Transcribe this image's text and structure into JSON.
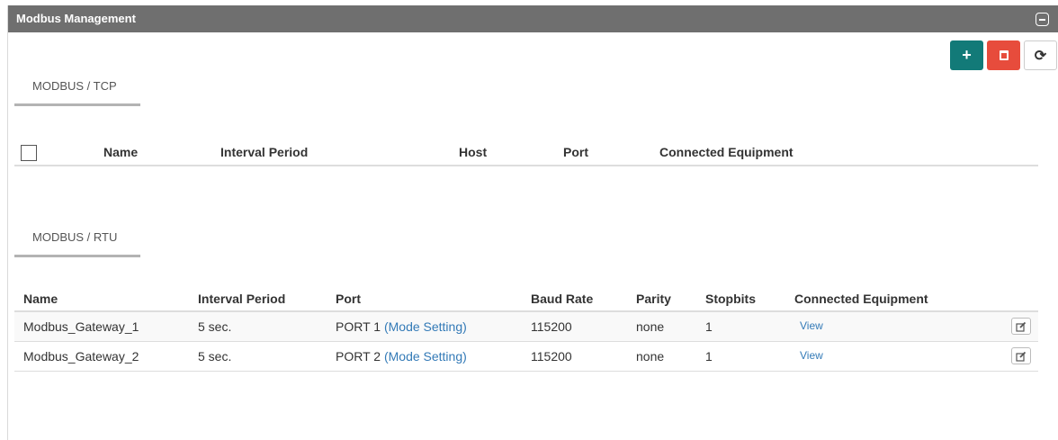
{
  "panel": {
    "title": "Modbus Management"
  },
  "toolbar": {
    "add_label": "+",
    "refresh_label": "⟳"
  },
  "tcp": {
    "tab_label": "MODBUS / TCP",
    "columns": [
      "Name",
      "Interval Period",
      "Host",
      "Port",
      "Connected Equipment"
    ]
  },
  "rtu": {
    "tab_label": "MODBUS / RTU",
    "columns": [
      "Name",
      "Interval Period",
      "Port",
      "Baud Rate",
      "Parity",
      "Stopbits",
      "Connected Equipment"
    ],
    "rows": [
      {
        "name": "Modbus_Gateway_1",
        "interval": "5 sec.",
        "port": "PORT 1",
        "mode_link": "(Mode Setting)",
        "baud": "115200",
        "parity": "none",
        "stopbits": "1",
        "equipment_link": "View"
      },
      {
        "name": "Modbus_Gateway_2",
        "interval": "5 sec.",
        "port": "PORT 2",
        "mode_link": "(Mode Setting)",
        "baud": "115200",
        "parity": "none",
        "stopbits": "1",
        "equipment_link": "View"
      }
    ]
  },
  "colors": {
    "header_bg": "#6f6f6f",
    "add": "#127a78",
    "delete": "#e74c3c",
    "link": "#337ab7"
  }
}
